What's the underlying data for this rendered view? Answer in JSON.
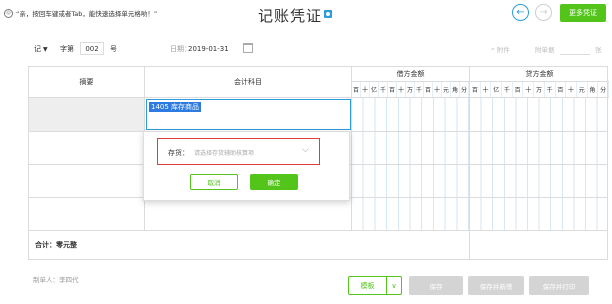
{
  "header": {
    "tip_icon": "circle-hint-icon",
    "tip_text": "“亲，按回车键或者Tab，能快速选择单元格哟！”",
    "title": "记账凭证",
    "title_icon": "video-icon",
    "prev_icon": "arrow-left-icon",
    "next_icon": "arrow-right-icon",
    "more_label": "更多凭证"
  },
  "meta": {
    "voucher_type": "记",
    "zi_label": "字第",
    "number": "002",
    "hao_label": "号",
    "date_label": "日期：",
    "date_value": "2019-01-31",
    "attach_label": "附件",
    "docs_label": "附单据",
    "docs_unit": "张"
  },
  "table": {
    "col_summary": "摘要",
    "col_subject": "会计科目",
    "col_debit": "借方金额",
    "col_credit": "贷方金额",
    "debit_digits": [
      "百",
      "十",
      "亿",
      "千",
      "百",
      "十",
      "万",
      "千",
      "百",
      "十",
      "元",
      "角",
      "分"
    ],
    "credit_digits": [
      "百",
      "十",
      "亿",
      "千",
      "百",
      "十",
      "万",
      "千",
      "百",
      "十",
      "元",
      "角",
      "分"
    ],
    "subject_value": "1405  库存商品",
    "total_label": "合计：零元整"
  },
  "popup": {
    "field_label": "存货：",
    "field_placeholder": "请选择存货辅助核算项",
    "cancel_label": "取消",
    "ok_label": "确定"
  },
  "footer": {
    "maker": "制单人：李四代",
    "template_label": "模板",
    "save_label": "保存",
    "save_new_label": "保存并新增",
    "save_print_label": "保存并打印"
  },
  "colors": {
    "accent_green": "#52c41a",
    "accent_blue": "#2d9cdb",
    "highlight_red": "#e03c3c"
  }
}
